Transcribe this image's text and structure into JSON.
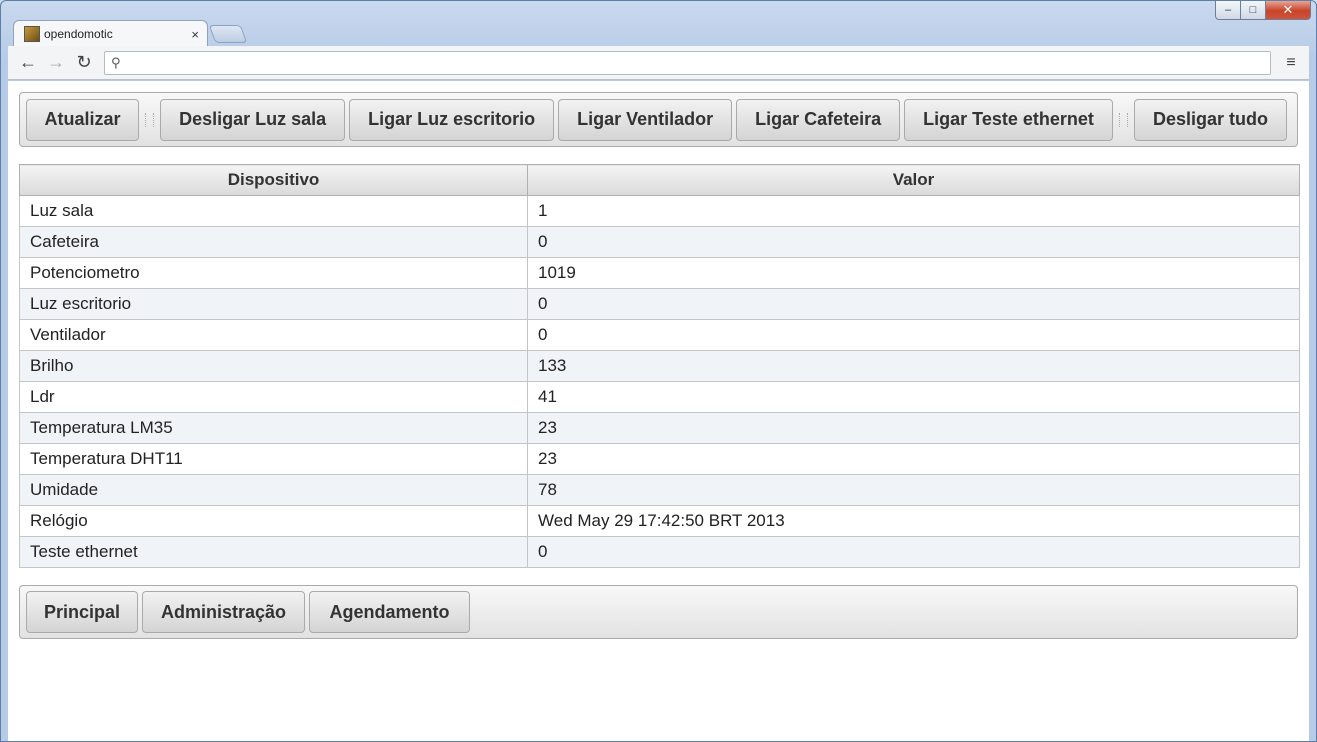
{
  "browser": {
    "tab_title": "opendomotic",
    "tab_close": "×",
    "address_value": "",
    "nav_back": "←",
    "nav_forward": "→",
    "nav_reload": "↻",
    "search_glyph": "⚲",
    "menu_glyph": "≡",
    "window_min": "–",
    "window_max": "□",
    "window_close": "✕"
  },
  "top_toolbar": {
    "refresh_label": "Atualizar",
    "actions": [
      "Desligar Luz sala",
      "Ligar Luz escritorio",
      "Ligar Ventilador",
      "Ligar Cafeteira",
      "Ligar Teste ethernet"
    ],
    "all_off_label": "Desligar tudo"
  },
  "table": {
    "headers": [
      "Dispositivo",
      "Valor"
    ],
    "rows": [
      [
        "Luz sala",
        "1"
      ],
      [
        "Cafeteira",
        "0"
      ],
      [
        "Potenciometro",
        "1019"
      ],
      [
        "Luz escritorio",
        "0"
      ],
      [
        "Ventilador",
        "0"
      ],
      [
        "Brilho",
        "133"
      ],
      [
        "Ldr",
        "41"
      ],
      [
        "Temperatura LM35",
        "23"
      ],
      [
        "Temperatura DHT11",
        "23"
      ],
      [
        "Umidade",
        "78"
      ],
      [
        "Relógio",
        "Wed May 29 17:42:50 BRT 2013"
      ],
      [
        "Teste ethernet",
        "0"
      ]
    ]
  },
  "bottom_nav": {
    "items": [
      "Principal",
      "Administração",
      "Agendamento"
    ]
  }
}
